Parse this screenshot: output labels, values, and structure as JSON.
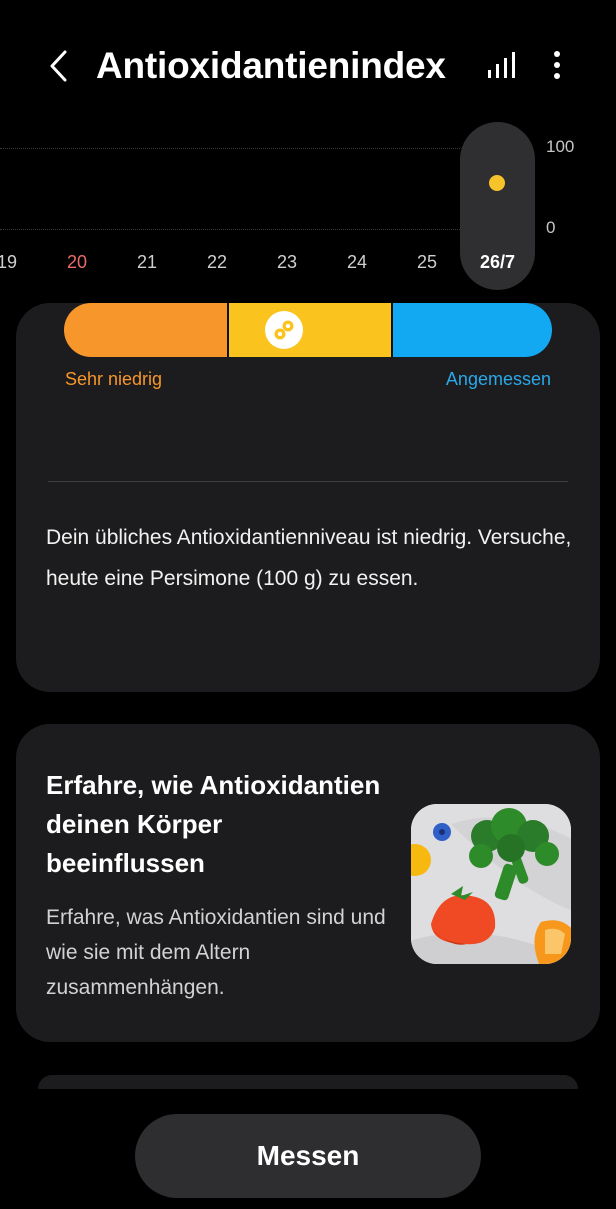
{
  "header": {
    "title": "Antioxidantienindex",
    "back_icon": "chevron-left-icon",
    "chart_icon": "bar-chart-icon",
    "more_icon": "more-vertical-icon"
  },
  "trend": {
    "y_max_label": "100",
    "y_min_label": "0",
    "days": [
      {
        "label": "19",
        "highlight": false
      },
      {
        "label": "20",
        "highlight": true
      },
      {
        "label": "21",
        "highlight": false
      },
      {
        "label": "22",
        "highlight": false
      },
      {
        "label": "23",
        "highlight": false
      },
      {
        "label": "24",
        "highlight": false
      },
      {
        "label": "25",
        "highlight": false
      }
    ],
    "selected_day": "26/7",
    "selected_level": "medium",
    "dot_color": "#f7c32a",
    "highlight_color": "#ee6a6a"
  },
  "level_card": {
    "scale": {
      "segments": [
        {
          "name": "low",
          "color": "#f7962b"
        },
        {
          "name": "medium",
          "color": "#fbc31e"
        },
        {
          "name": "adequate",
          "color": "#12a9f2"
        }
      ],
      "current_segment": "medium",
      "low_label": "Sehr niedrig",
      "high_label": "Angemessen"
    },
    "advice": "Dein übliches Antioxidantienniveau ist niedrig. Versuche, heute eine Persimone (100 g) zu essen."
  },
  "info_card": {
    "title": "Erfahre, wie Antioxidantien deinen Körper beeinflussen",
    "body": "Erfahre, was Antioxidantien sind und wie sie mit dem Altern zusammenhängen.",
    "image_icon": "fruits-vegetables-illustration-icon"
  },
  "bottom": {
    "measure_label": "Messen"
  }
}
